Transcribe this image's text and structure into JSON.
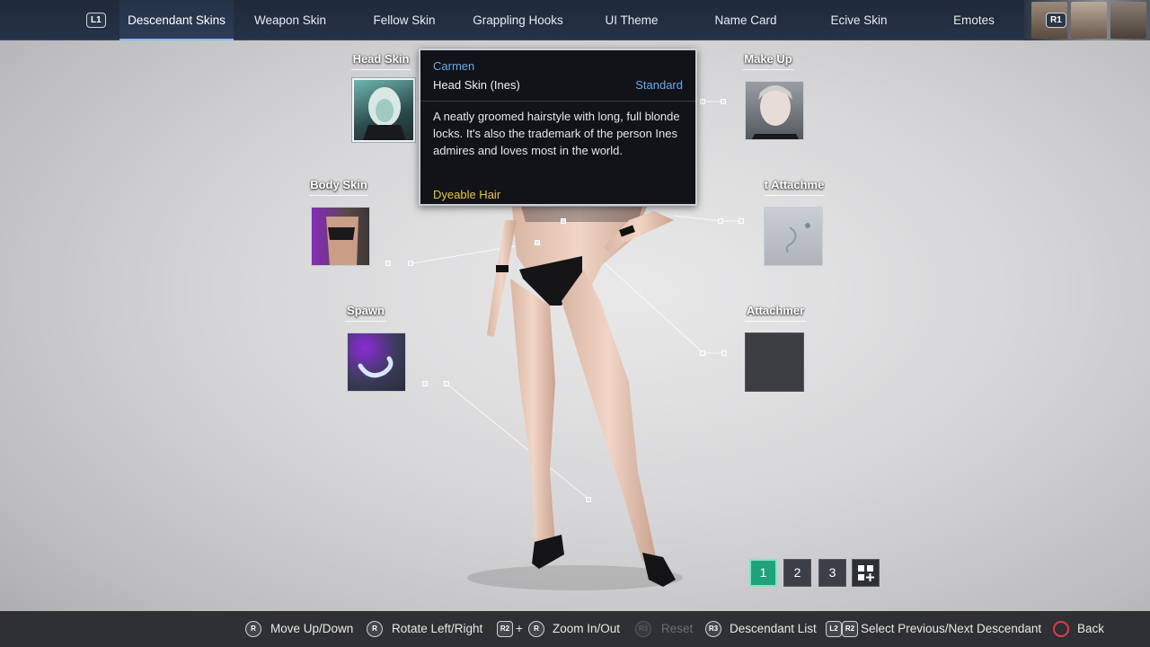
{
  "topnav": {
    "left_bumper": "L1",
    "right_bumper": "R1",
    "tabs": [
      {
        "label": "Descendant Skins",
        "active": true
      },
      {
        "label": "Weapon Skin",
        "active": false
      },
      {
        "label": "Fellow Skin",
        "active": false
      },
      {
        "label": "Grappling Hooks",
        "active": false
      },
      {
        "label": "UI Theme",
        "active": false
      },
      {
        "label": "Name Card",
        "active": false
      },
      {
        "label": "Ecive Skin",
        "active": false
      },
      {
        "label": "Emotes",
        "active": false
      }
    ]
  },
  "slots": {
    "head_skin": "Head Skin",
    "body_skin": "Body Skin",
    "spawn": "Spawn",
    "make_up": "Make Up",
    "front_attachment": "t Attachme",
    "back_attachment": "Attachmer"
  },
  "tooltip": {
    "name": "Carmen",
    "type": "Head Skin (Ines)",
    "grade": "Standard",
    "description": "A neatly groomed hairstyle with long, full blonde locks. It's also the trademark of the person Ines admires and loves most in the world.",
    "feature": "Dyeable Hair"
  },
  "presets": {
    "pages": [
      "1",
      "2",
      "3"
    ],
    "active_page": "1",
    "add_icon": "grid-plus-icon"
  },
  "bottombar": {
    "move": {
      "button": "R",
      "label": "Move Up/Down"
    },
    "rotate": {
      "button": "R",
      "label": "Rotate Left/Right"
    },
    "zoom": {
      "button1": "R2",
      "plus": "+",
      "button2": "R",
      "label": "Zoom In/Out"
    },
    "reset": {
      "button": "R3",
      "label": "Reset"
    },
    "list": {
      "button": "R3",
      "label": "Descendant List"
    },
    "switch": {
      "button1": "L2",
      "button2": "R2",
      "label": "Select Previous/Next Descendant"
    },
    "back": {
      "button": "",
      "label": "Back"
    }
  },
  "colors": {
    "accent_blue": "#6fa9e8",
    "feature_yellow": "#e8c63a",
    "active_page": "#1fa37a"
  }
}
